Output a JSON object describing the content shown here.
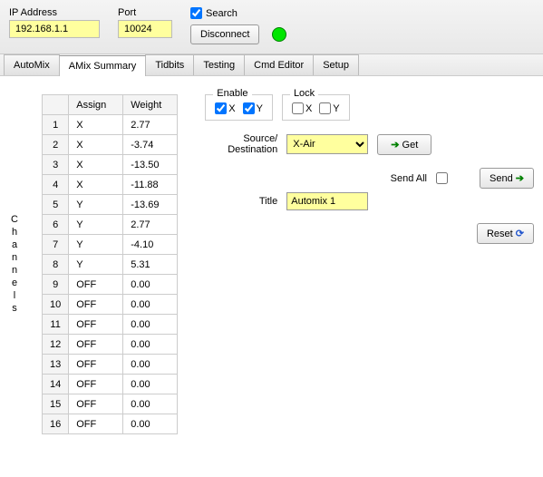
{
  "topbar": {
    "ip_label": "IP Address",
    "ip_value": "192.168.1.1",
    "port_label": "Port",
    "port_value": "10024",
    "search_label": "Search",
    "search_checked": true,
    "disconnect_label": "Disconnect",
    "status_color": "#00e600"
  },
  "tabs": [
    "AutoMix",
    "AMix Summary",
    "Tidbits",
    "Testing",
    "Cmd Editor",
    "Setup"
  ],
  "active_tab": 1,
  "channels_label": "Channels",
  "table": {
    "col_assign": "Assign",
    "col_weight": "Weight",
    "rows": [
      {
        "n": "1",
        "assign": "X",
        "weight": "2.77"
      },
      {
        "n": "2",
        "assign": "X",
        "weight": "-3.74"
      },
      {
        "n": "3",
        "assign": "X",
        "weight": "-13.50"
      },
      {
        "n": "4",
        "assign": "X",
        "weight": "-11.88"
      },
      {
        "n": "5",
        "assign": "Y",
        "weight": "-13.69"
      },
      {
        "n": "6",
        "assign": "Y",
        "weight": "2.77"
      },
      {
        "n": "7",
        "assign": "Y",
        "weight": "-4.10"
      },
      {
        "n": "8",
        "assign": "Y",
        "weight": "5.31"
      },
      {
        "n": "9",
        "assign": "OFF",
        "weight": "0.00"
      },
      {
        "n": "10",
        "assign": "OFF",
        "weight": "0.00"
      },
      {
        "n": "11",
        "assign": "OFF",
        "weight": "0.00"
      },
      {
        "n": "12",
        "assign": "OFF",
        "weight": "0.00"
      },
      {
        "n": "13",
        "assign": "OFF",
        "weight": "0.00"
      },
      {
        "n": "14",
        "assign": "OFF",
        "weight": "0.00"
      },
      {
        "n": "15",
        "assign": "OFF",
        "weight": "0.00"
      },
      {
        "n": "16",
        "assign": "OFF",
        "weight": "0.00"
      }
    ]
  },
  "enable": {
    "legend": "Enable",
    "x_label": "X",
    "x_checked": true,
    "y_label": "Y",
    "y_checked": true
  },
  "lock": {
    "legend": "Lock",
    "x_label": "X",
    "x_checked": false,
    "y_label": "Y",
    "y_checked": false
  },
  "source": {
    "label": "Source/\nDestination",
    "value": "X-Air",
    "options": [
      "X-Air"
    ]
  },
  "get_label": "Get",
  "send_all_label": "Send All",
  "send_all_checked": false,
  "title_label": "Title",
  "title_value": "Automix 1",
  "send_label": "Send",
  "reset_label": "Reset"
}
